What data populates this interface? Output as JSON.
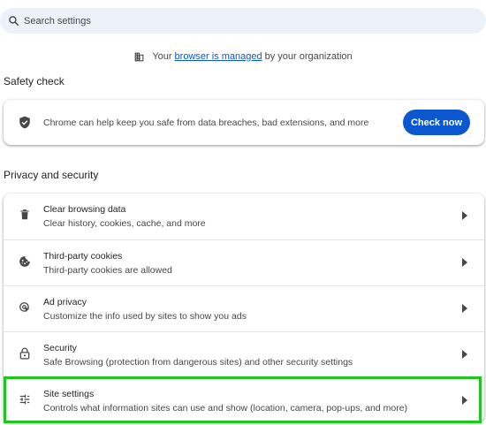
{
  "search": {
    "placeholder": "Search settings"
  },
  "managed_notice": {
    "prefix": "Your",
    "link": "browser is managed",
    "suffix": "by your organization"
  },
  "safety_check": {
    "title": "Safety check",
    "description": "Chrome can help keep you safe from data breaches, bad extensions, and more",
    "button_label": "Check now"
  },
  "privacy": {
    "title": "Privacy and security",
    "items": [
      {
        "icon": "trash-icon",
        "title": "Clear browsing data",
        "subtitle": "Clear history, cookies, cache, and more"
      },
      {
        "icon": "cookie-icon",
        "title": "Third-party cookies",
        "subtitle": "Third-party cookies are allowed"
      },
      {
        "icon": "ad-privacy-icon",
        "title": "Ad privacy",
        "subtitle": "Customize the info used by sites to show you ads"
      },
      {
        "icon": "lock-icon",
        "title": "Security",
        "subtitle": "Safe Browsing (protection from dangerous sites) and other security settings"
      },
      {
        "icon": "sliders-icon",
        "title": "Site settings",
        "subtitle": "Controls what information sites can use and show (location, camera, pop-ups, and more)"
      }
    ]
  },
  "colors": {
    "accent": "#0b57d0",
    "highlight": "#1fc71f",
    "search_bg": "#edf2fa"
  }
}
